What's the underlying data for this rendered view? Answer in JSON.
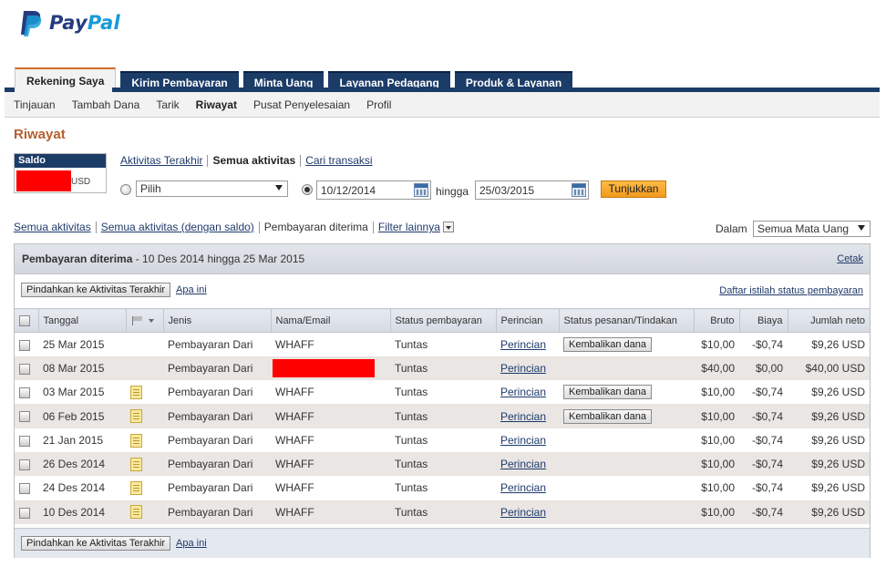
{
  "brand": {
    "pay": "Pay",
    "pal": "Pal"
  },
  "tabs": [
    {
      "label": "Rekening Saya",
      "active": true
    },
    {
      "label": "Kirim Pembayaran"
    },
    {
      "label": "Minta Uang"
    },
    {
      "label": "Layanan Pedagang"
    },
    {
      "label": "Produk & Layanan"
    }
  ],
  "subnav": [
    "Tinjauan",
    "Tambah Dana",
    "Tarik",
    "Riwayat",
    "Pusat Penyelesaian",
    "Profil"
  ],
  "page_title": "Riwayat",
  "saldo": {
    "label": "Saldo",
    "currency": "USD"
  },
  "views": {
    "recent": "Aktivitas Terakhir",
    "all": "Semua aktivitas",
    "search": "Cari transaksi"
  },
  "filter": {
    "select_value": "Pilih",
    "date_from": "10/12/2014",
    "to_label": "hingga",
    "date_to": "25/03/2015",
    "show_button": "Tunjukkan"
  },
  "sublinks": {
    "all": "Semua aktivitas",
    "all_saldo": "Semua aktivitas (dengan saldo)",
    "received": "Pembayaran diterima",
    "more": "Filter lainnya"
  },
  "currency": {
    "label": "Dalam",
    "value": "Semua Mata Uang"
  },
  "panel": {
    "title_bold": "Pembayaran diterima",
    "title_range": " - 10 Des 2014 hingga 25 Mar 2015",
    "print": "Cetak",
    "move_button": "Pindahkan ke Aktivitas Terakhir",
    "what": "Apa ini",
    "status_glossary": "Daftar istilah status pembayaran"
  },
  "columns": [
    "Tanggal",
    "Jenis",
    "Nama/Email",
    "Status pembayaran",
    "Perincian",
    "Status pesanan/Tindakan",
    "Bruto",
    "Biaya",
    "Jumlah neto"
  ],
  "rows": [
    {
      "date": "25 Mar 2015",
      "note": false,
      "type": "Pembayaran Dari",
      "name": "WHAFF",
      "status": "Tuntas",
      "detail": "Perincian",
      "action": "Kembalikan dana",
      "gross": "$10,00",
      "fee": "-$0,74",
      "net": "$9,26 USD"
    },
    {
      "date": "08 Mar 2015",
      "note": false,
      "type": "Pembayaran Dari",
      "name": "",
      "redacted": true,
      "status": "Tuntas",
      "detail": "Perincian",
      "action": "",
      "gross": "$40,00",
      "fee": "$0,00",
      "net": "$40,00 USD"
    },
    {
      "date": "03 Mar 2015",
      "note": true,
      "type": "Pembayaran Dari",
      "name": "WHAFF",
      "status": "Tuntas",
      "detail": "Perincian",
      "action": "Kembalikan dana",
      "gross": "$10,00",
      "fee": "-$0,74",
      "net": "$9,26 USD"
    },
    {
      "date": "06 Feb 2015",
      "note": true,
      "type": "Pembayaran Dari",
      "name": "WHAFF",
      "status": "Tuntas",
      "detail": "Perincian",
      "action": "Kembalikan dana",
      "gross": "$10,00",
      "fee": "-$0,74",
      "net": "$9,26 USD"
    },
    {
      "date": "21 Jan 2015",
      "note": true,
      "type": "Pembayaran Dari",
      "name": "WHAFF",
      "status": "Tuntas",
      "detail": "Perincian",
      "action": "",
      "gross": "$10,00",
      "fee": "-$0,74",
      "net": "$9,26 USD"
    },
    {
      "date": "26 Des 2014",
      "note": true,
      "type": "Pembayaran Dari",
      "name": "WHAFF",
      "status": "Tuntas",
      "detail": "Perincian",
      "action": "",
      "gross": "$10,00",
      "fee": "-$0,74",
      "net": "$9,26 USD"
    },
    {
      "date": "24 Des 2014",
      "note": true,
      "type": "Pembayaran Dari",
      "name": "WHAFF",
      "status": "Tuntas",
      "detail": "Perincian",
      "action": "",
      "gross": "$10,00",
      "fee": "-$0,74",
      "net": "$9,26 USD"
    },
    {
      "date": "10 Des 2014",
      "note": true,
      "type": "Pembayaran Dari",
      "name": "WHAFF",
      "status": "Tuntas",
      "detail": "Perincian",
      "action": "",
      "gross": "$10,00",
      "fee": "-$0,74",
      "net": "$9,26 USD"
    }
  ],
  "colors": {
    "navy": "#1c3c68",
    "orange_title": "#b3612e",
    "button_orange": "#f39a1b",
    "redaction": "#ff0000"
  }
}
